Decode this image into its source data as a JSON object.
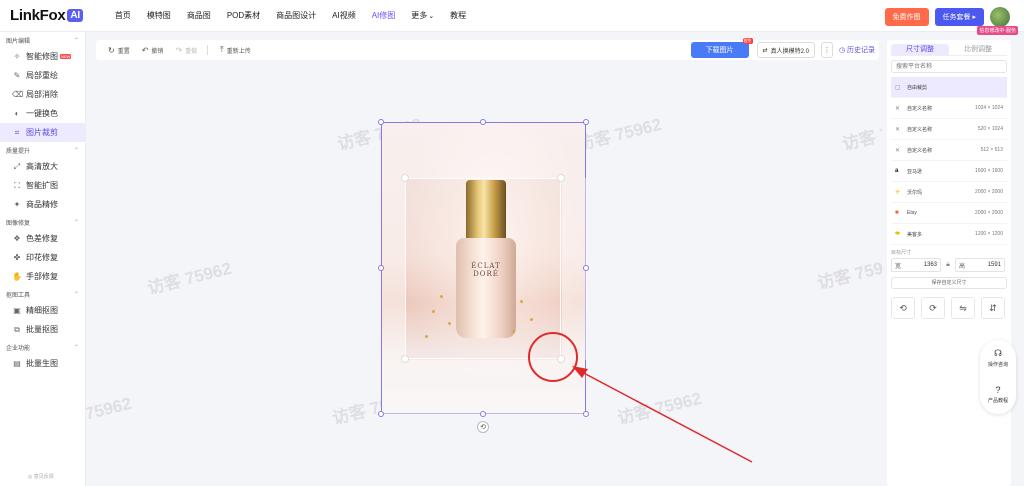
{
  "app": {
    "logo_text": "LinkFox",
    "logo_badge": "AI"
  },
  "nav": [
    {
      "label": "首页"
    },
    {
      "label": "模特图"
    },
    {
      "label": "商品图"
    },
    {
      "label": "POD素材"
    },
    {
      "label": "商品图设计"
    },
    {
      "label": "AI视频"
    },
    {
      "label": "AI修图",
      "active": true
    },
    {
      "label": "更多",
      "has_dropdown": true
    },
    {
      "label": "教程"
    }
  ],
  "header_right": {
    "free_button": "免费作图",
    "enterprise_button": "任务套餐 ▸",
    "avatar_tag": "信息修改中·服务"
  },
  "sidebar": {
    "sections": [
      {
        "title": "图片编辑",
        "items": [
          {
            "label": "智能修图",
            "icon": "sparkle-icon",
            "badge": "NEW"
          },
          {
            "label": "局部重绘",
            "icon": "brush-icon"
          },
          {
            "label": "局部消除",
            "icon": "eraser-icon"
          },
          {
            "label": "一键换色",
            "icon": "palette-icon"
          },
          {
            "label": "图片裁剪",
            "icon": "crop-icon",
            "active": true
          }
        ]
      },
      {
        "title": "质量提升",
        "items": [
          {
            "label": "高清放大",
            "icon": "upscale-icon"
          },
          {
            "label": "智能扩图",
            "icon": "expand-icon"
          },
          {
            "label": "商品精修",
            "icon": "retouch-icon"
          }
        ]
      },
      {
        "title": "图像修复",
        "items": [
          {
            "label": "色差修复",
            "icon": "color-fix-icon"
          },
          {
            "label": "印花修复",
            "icon": "print-fix-icon"
          },
          {
            "label": "手部修复",
            "icon": "hand-icon"
          }
        ]
      },
      {
        "title": "抠图工具",
        "items": [
          {
            "label": "精细抠图",
            "icon": "cutout-icon"
          },
          {
            "label": "批量抠图",
            "icon": "batch-cutout-icon"
          }
        ]
      },
      {
        "title": "企业功能",
        "items": [
          {
            "label": "批量生图",
            "icon": "batch-image-icon"
          }
        ]
      }
    ],
    "footer": "◎ 意见反馈"
  },
  "toolbar": {
    "redo_all": "重置",
    "undo": "撤销",
    "redo": "重做",
    "reupload": "重新上传",
    "download": "下载图片",
    "download_badge": "限免",
    "model_button": "真人换模特2.0",
    "history": "历史记录"
  },
  "canvas": {
    "watermark": "访客 75962",
    "product_label": [
      "ÉCLAT",
      "DORÉ"
    ]
  },
  "right_panel": {
    "tabs": [
      {
        "label": "尺寸调整",
        "active": true
      },
      {
        "label": "比例调整"
      }
    ],
    "search_placeholder": "搜索平台名称",
    "presets": [
      {
        "name": "自由裁剪",
        "size": "",
        "icon": "free-crop-icon",
        "active": true
      },
      {
        "name": "自定义名称",
        "size": "1024 × 1024",
        "icon": "custom-icon"
      },
      {
        "name": "自定义名称",
        "size": "520 × 1024",
        "icon": "custom-icon"
      },
      {
        "name": "自定义名称",
        "size": "512 × 512",
        "icon": "custom-icon"
      },
      {
        "name": "亚马逊",
        "size": "1600 × 1600",
        "icon": "amazon-icon"
      },
      {
        "name": "沃尔玛",
        "size": "2000 × 2000",
        "icon": "walmart-icon"
      },
      {
        "name": "Etsy",
        "size": "2000 × 2000",
        "icon": "etsy-icon"
      },
      {
        "name": "美客多",
        "size": "1200 × 1200",
        "icon": "mercado-icon"
      }
    ],
    "output_label": "目标尺寸",
    "width_label": "宽",
    "width_value": "1363",
    "height_label": "高",
    "height_value": "1591",
    "save_custom": "保存自定义尺寸"
  },
  "help": {
    "consult": "操作咨询",
    "tutorial": "产品教程"
  },
  "colors": {
    "accent": "#5b4ee6",
    "annotation": "#e02a2a"
  }
}
